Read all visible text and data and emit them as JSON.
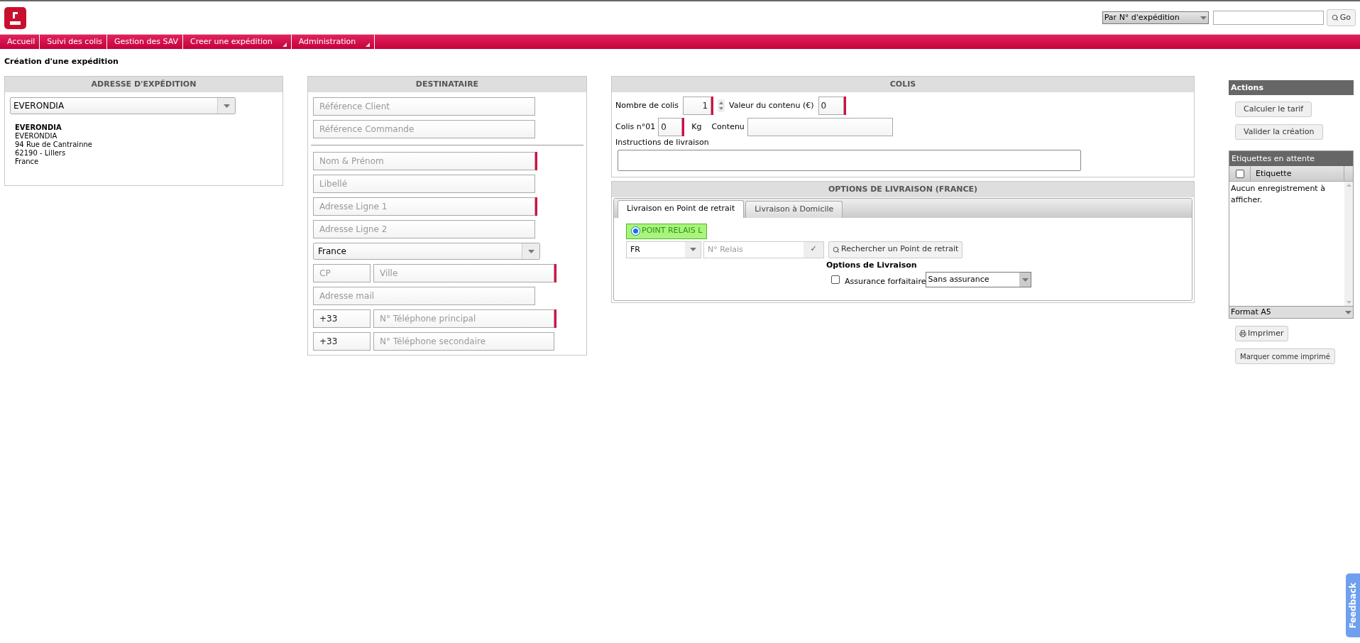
{
  "search": {
    "mode": "Par N° d'expédition",
    "button": "Go"
  },
  "nav": [
    {
      "label": "Accueil",
      "dropdown": false
    },
    {
      "label": "Suivi des colis",
      "dropdown": false
    },
    {
      "label": "Gestion des SAV",
      "dropdown": false
    },
    {
      "label": "Creer une expédition",
      "dropdown": true
    },
    {
      "label": "Administration",
      "dropdown": true
    }
  ],
  "page_title": "Création d'une expédition",
  "sender": {
    "title": "ADRESSE D'EXPÉDITION",
    "select": "EVERONDIA",
    "address": [
      "EVERONDIA",
      "EVERONDIA",
      "94 Rue de Cantrainne",
      "62190 - Lillers",
      "France"
    ]
  },
  "recipient": {
    "title": "DESTINATAIRE",
    "fields": [
      {
        "kind": "input",
        "placeholder": "Référence Client",
        "required": false
      },
      {
        "kind": "input",
        "placeholder": "Référence Commande",
        "required": false
      },
      {
        "kind": "divider"
      },
      {
        "kind": "input",
        "placeholder": "Nom & Prénom",
        "required": true
      },
      {
        "kind": "input",
        "placeholder": "Libellé",
        "required": false
      },
      {
        "kind": "input",
        "placeholder": "Adresse Ligne 1",
        "required": true
      },
      {
        "kind": "input",
        "placeholder": "Adresse Ligne 2",
        "required": false
      },
      {
        "kind": "select",
        "value": "France"
      },
      {
        "kind": "pair",
        "first": {
          "placeholder": "CP"
        },
        "second": {
          "placeholder": "Ville"
        },
        "required": true
      },
      {
        "kind": "input",
        "placeholder": "Adresse mail",
        "required": false
      },
      {
        "kind": "pair",
        "first": {
          "value": "+33"
        },
        "second": {
          "placeholder": "N° Téléphone principal"
        },
        "required": true
      },
      {
        "kind": "pair",
        "first": {
          "value": "+33"
        },
        "second": {
          "placeholder": "N° Téléphone secondaire"
        },
        "required": false
      }
    ]
  },
  "parcel": {
    "title": "COLIS",
    "count_label": "Nombre de colis",
    "count": "1",
    "value_label": "Valeur du contenu (€)",
    "value": "0",
    "weight_label": "Colis n°01",
    "weight": "0",
    "weight_unit": "Kg",
    "content_label": "Contenu",
    "instructions_label": "Instructions de livraison"
  },
  "delivery": {
    "title": "OPTIONS DE LIVRAISON (FRANCE)",
    "tabs": [
      {
        "label": "Livraison en Point de retrait",
        "selected": true
      },
      {
        "label": "Livraison à Domicile",
        "selected": false
      }
    ],
    "relay_option": {
      "label": "POINT RELAIS L",
      "selected": true
    },
    "country": "FR",
    "relay_placeholder": "N° Relais",
    "check": "✓",
    "search_button": "Rechercher un Point de retrait",
    "options_title": "Options de Livraison",
    "insurance_label": "Assurance forfaitaire",
    "insurance_checked": false,
    "insurance_select": "Sans assurance"
  },
  "actions": {
    "title": "Actions",
    "buttons": [
      "Calculer le tarif",
      "Valider la création"
    ]
  },
  "labels": {
    "title": "Etiquettes en attente",
    "column": "Etiquette",
    "all_checked": false,
    "empty": "Aucun enregistrement à afficher.",
    "format": "Format A5",
    "print": "Imprimer",
    "mark": "Marquer comme imprimé"
  },
  "feedback": "Feedback"
}
